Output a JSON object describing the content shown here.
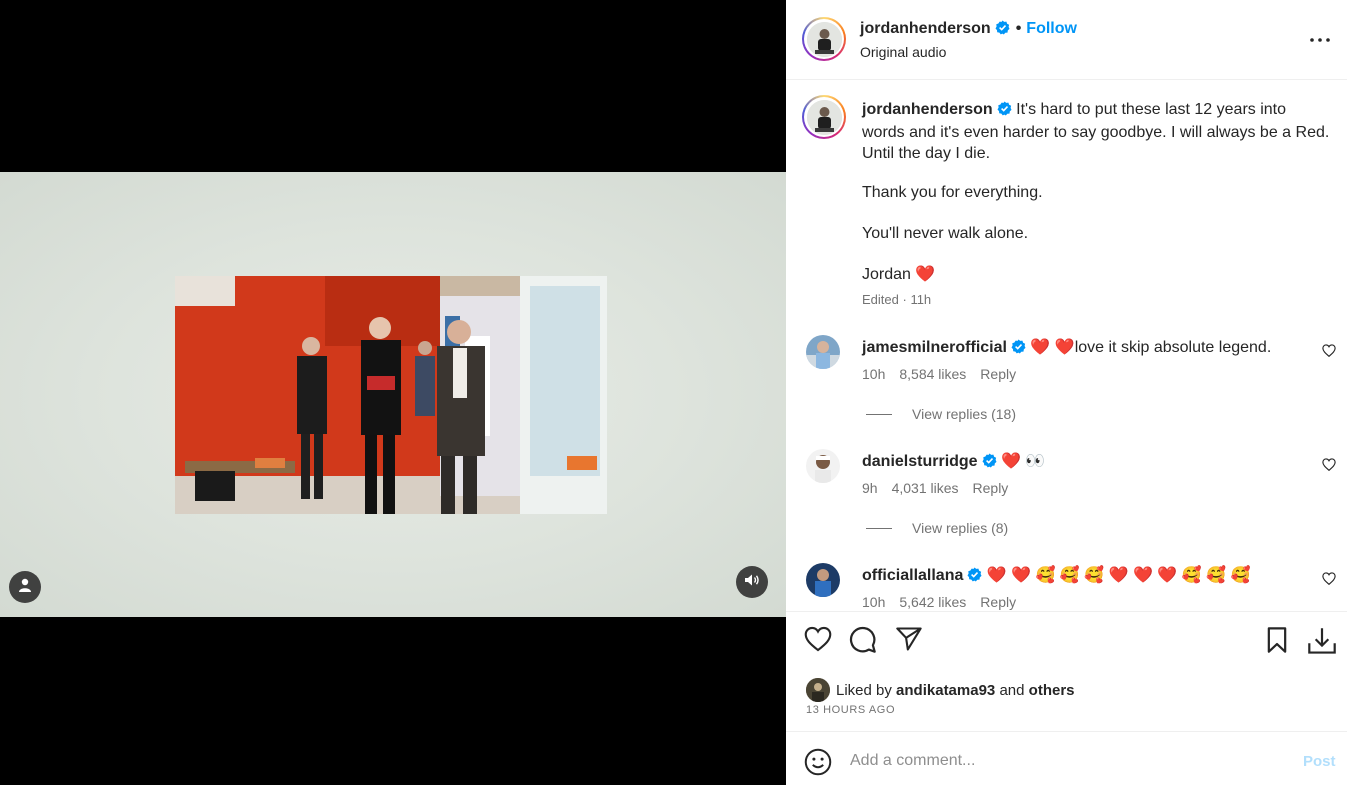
{
  "post": {
    "username": "jordanhenderson",
    "follow_label": "Follow",
    "separator": "•",
    "audio": "Original audio",
    "more_icon": "more-horizontal-icon"
  },
  "caption": {
    "username": "jordanhenderson",
    "paragraphs": [
      "It's hard to put these last 12 years into words and it's even harder to say goodbye. I will always be a Red. Until the day I die.",
      "Thank you for everything.",
      "You'll never walk alone.",
      "Jordan"
    ],
    "signoff_emoji": "❤️",
    "edited": "Edited",
    "time": "11h"
  },
  "comments": [
    {
      "username": "jamesmilnerofficial",
      "text": "❤️ ❤️love it skip absolute legend.",
      "time": "10h",
      "likes": "8,584 likes",
      "reply_label": "Reply",
      "view_replies": "View replies (18)"
    },
    {
      "username": "danielsturridge",
      "text": "❤️ 👀",
      "time": "9h",
      "likes": "4,031 likes",
      "reply_label": "Reply",
      "view_replies": "View replies (8)"
    },
    {
      "username": "officiallallana",
      "text": "❤️ ❤️ 🥰 🥰 🥰 ❤️ ❤️ ❤️ 🥰 🥰 🥰",
      "time": "10h",
      "likes": "5,642 likes",
      "reply_label": "Reply"
    }
  ],
  "actions": {
    "like_icon": "heart-icon",
    "comment_icon": "comment-icon",
    "share_icon": "send-icon",
    "save_icon": "bookmark-icon",
    "download_icon": "download-icon"
  },
  "likes": {
    "prefix": "Liked by",
    "user": "andikatama93",
    "and": "and",
    "others": "others",
    "time_ago": "13 HOURS AGO"
  },
  "add_comment": {
    "placeholder": "Add a comment...",
    "post_label": "Post"
  },
  "colors": {
    "accent": "#0095f6",
    "verified": "#0095f6",
    "heart": "#ed4956",
    "post_disabled": "#b2dffc"
  }
}
